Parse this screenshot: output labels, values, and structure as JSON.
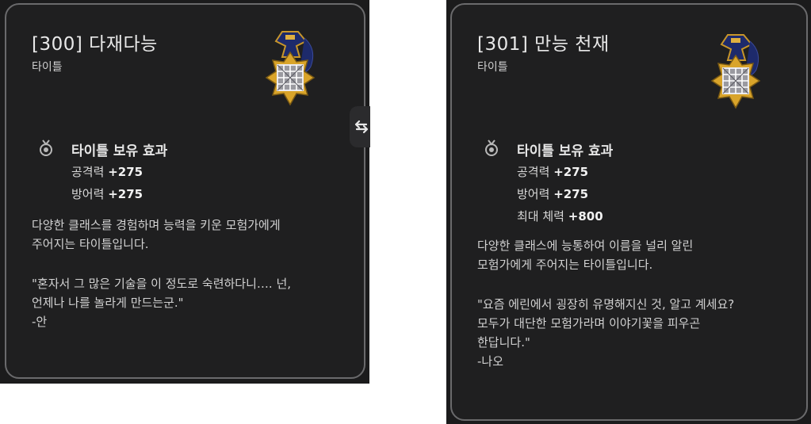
{
  "cards": [
    {
      "title": "[300] 다재다능",
      "type": "타이틀",
      "effect_header": "타이틀 보유 효과",
      "stats": [
        {
          "label": "공격력",
          "value": "+275"
        },
        {
          "label": "방어력",
          "value": "+275"
        }
      ],
      "description": [
        "다양한 클래스를 경험하며 능력을 키운 모험가에게",
        "주어지는 타이틀입니다."
      ],
      "quote": [
        "\"혼자서 그 많은 기술을 이 정도로 숙련하다니…. 넌,",
        "언제나 나를 놀라게 만드는군.\"",
        "-안"
      ]
    },
    {
      "title": "[301] 만능 천재",
      "type": "타이틀",
      "effect_header": "타이틀 보유 효과",
      "stats": [
        {
          "label": "공격력",
          "value": "+275"
        },
        {
          "label": "방어력",
          "value": "+275"
        },
        {
          "label": "최대 체력",
          "value": "+800"
        }
      ],
      "description": [
        "다양한 클래스에 능통하여 이름을 널리 알린",
        "모험가에게 주어지는 타이틀입니다."
      ],
      "quote": [
        "\"요즘 에린에서 굉장히 유명해지신 것, 알고 계세요?",
        "모두가 대단한 모험가라며 이야기꽃을 피우곤",
        "한답니다.\"",
        "-나오"
      ]
    }
  ],
  "icons": {
    "medal": "title-medal-icon",
    "effect": "medal-ribbon-icon",
    "swap": "swap-arrows-icon"
  },
  "colors": {
    "card_bg": "#1f1f20",
    "card_border": "#6a6a6c",
    "medal_gold": "#d9a42a",
    "medal_navy": "#1d2a6b"
  }
}
